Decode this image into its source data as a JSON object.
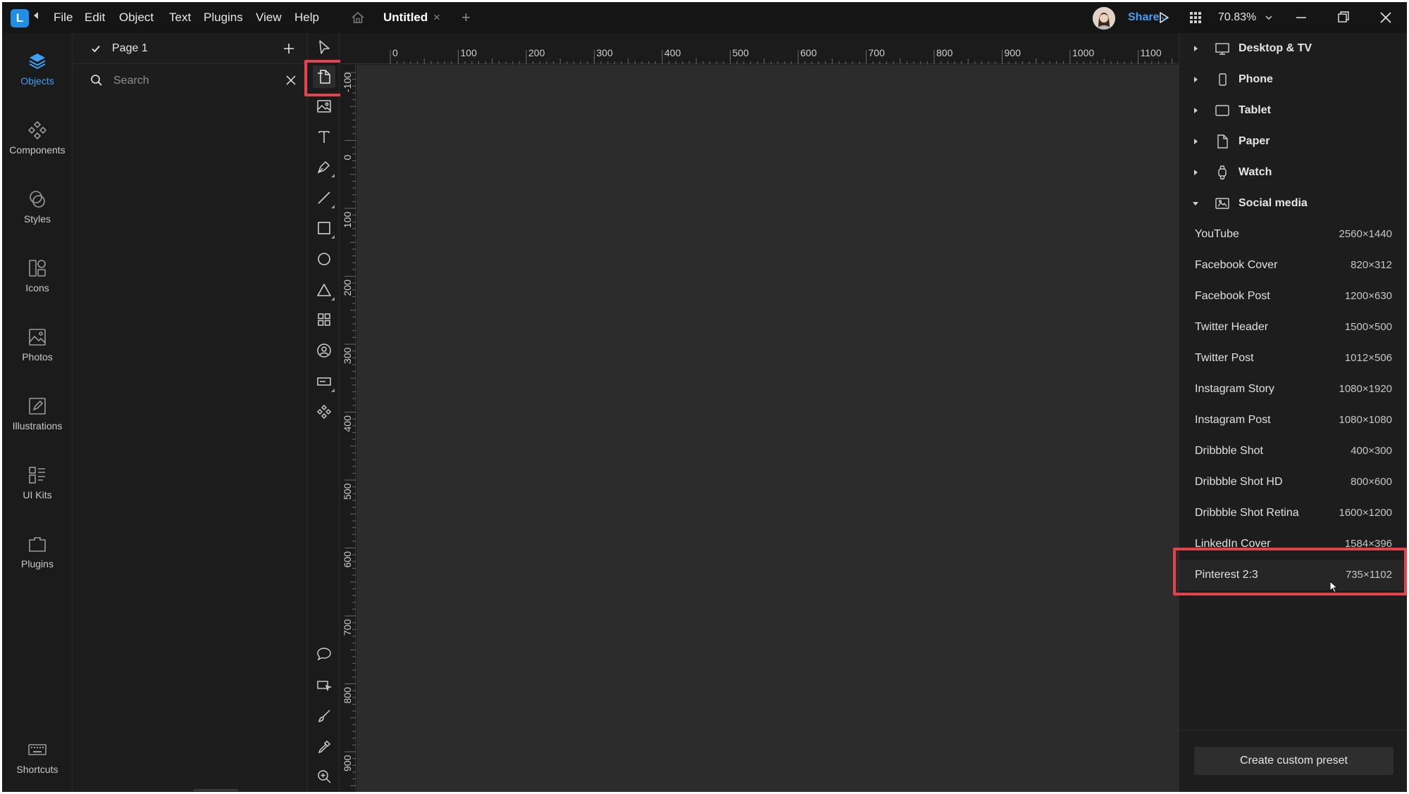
{
  "colors": {
    "accent": "#3da0f5",
    "highlight": "#e5424b",
    "canvas": "#2c2c2c",
    "panel": "#1d1d1d"
  },
  "menu": [
    "File",
    "Edit",
    "Object",
    "Text",
    "Plugins",
    "View",
    "Help"
  ],
  "document": {
    "tab_title": "Untitled",
    "tab_close": "×",
    "tab_add": "+"
  },
  "topbar": {
    "zoom": "70.83%",
    "share_label": "Share"
  },
  "leftnav": {
    "items": [
      {
        "label": "Objects",
        "icon": "layers-icon"
      },
      {
        "label": "Components",
        "icon": "components-icon"
      },
      {
        "label": "Styles",
        "icon": "styles-icon"
      },
      {
        "label": "Icons",
        "icon": "icons-icon"
      },
      {
        "label": "Photos",
        "icon": "photos-icon"
      },
      {
        "label": "Illustrations",
        "icon": "illustrations-icon"
      },
      {
        "label": "UI Kits",
        "icon": "ui-kits-icon"
      },
      {
        "label": "Plugins",
        "icon": "plugins-icon"
      }
    ],
    "shortcuts_label": "Shortcuts"
  },
  "layers": {
    "page_name": "Page 1",
    "search_placeholder": "Search"
  },
  "ruler": {
    "horizontal": [
      "0",
      "100",
      "200",
      "300",
      "400",
      "500",
      "600",
      "700",
      "800",
      "900",
      "1000",
      "1100"
    ],
    "vertical": [
      "-100",
      "0",
      "100",
      "200",
      "300",
      "400",
      "500",
      "600",
      "700",
      "800",
      "900"
    ]
  },
  "presets": {
    "categories": [
      {
        "label": "Desktop & TV",
        "icon": "monitor-icon",
        "expanded": false
      },
      {
        "label": "Phone",
        "icon": "phone-icon",
        "expanded": false
      },
      {
        "label": "Tablet",
        "icon": "tablet-icon",
        "expanded": false
      },
      {
        "label": "Paper",
        "icon": "paper-icon",
        "expanded": false
      },
      {
        "label": "Watch",
        "icon": "watch-icon",
        "expanded": false
      },
      {
        "label": "Social media",
        "icon": "social-media-icon",
        "expanded": true
      }
    ],
    "social_media": [
      {
        "name": "YouTube",
        "size": "2560×1440"
      },
      {
        "name": "Facebook Cover",
        "size": "820×312"
      },
      {
        "name": "Facebook Post",
        "size": "1200×630"
      },
      {
        "name": "Twitter Header",
        "size": "1500×500"
      },
      {
        "name": "Twitter Post",
        "size": "1012×506"
      },
      {
        "name": "Instagram Story",
        "size": "1080×1920"
      },
      {
        "name": "Instagram Post",
        "size": "1080×1080"
      },
      {
        "name": "Dribbble Shot",
        "size": "400×300"
      },
      {
        "name": "Dribbble Shot HD",
        "size": "800×600"
      },
      {
        "name": "Dribbble Shot Retina",
        "size": "1600×1200"
      },
      {
        "name": "LinkedIn Cover",
        "size": "1584×396"
      },
      {
        "name": "Pinterest 2:3",
        "size": "735×1102"
      }
    ],
    "custom_button": "Create custom preset"
  }
}
